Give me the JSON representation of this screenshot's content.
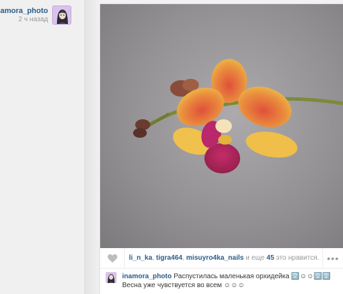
{
  "author": {
    "username": "inamora_photo",
    "time_ago": "2 ч назад",
    "avatar_icon": "avatar-girl-icon"
  },
  "post": {
    "photo_subject": "orchid-photo",
    "likes": {
      "likers": [
        "li_n_ka",
        "tigra464",
        "misuyro4ka_nails"
      ],
      "separator_1": ", ",
      "separator_2": ", ",
      "and_more_prefix": " и еще ",
      "count": "45",
      "suffix": " это нравится."
    },
    "more_icon": "•••",
    "caption": {
      "username": "inamora_photo",
      "line1": "Распустилась маленькая орхидейка 🈳☺☺🈳🈳",
      "line2": "Весна уже чувствуется во всем ☺☺☺"
    }
  },
  "colors": {
    "link": "#2d5c88",
    "muted": "#999999",
    "background": "#f2f2f2"
  }
}
